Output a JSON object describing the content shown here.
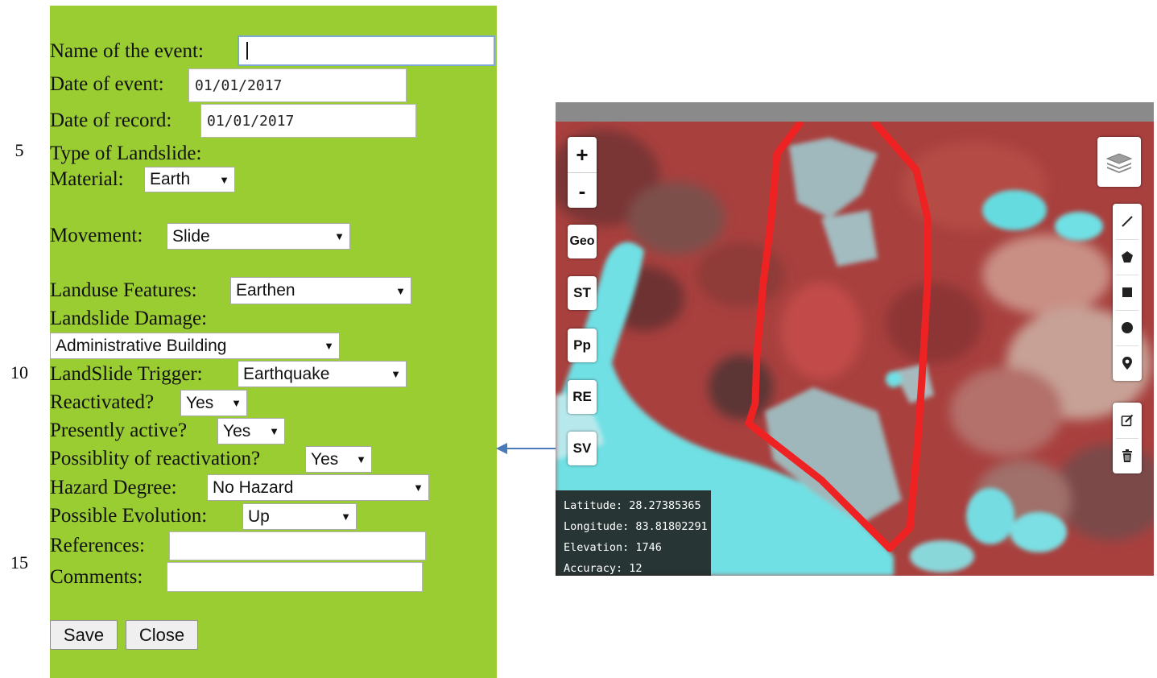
{
  "line_numbers": [
    "5",
    "10",
    "15"
  ],
  "form": {
    "event_name": {
      "label": "Name of the event:",
      "value": ""
    },
    "event_date": {
      "label": "Date of event:",
      "value": "01/01/2017"
    },
    "record_date": {
      "label": "Date of record:",
      "value": "01/01/2017"
    },
    "type_heading": "Type of Landslide:",
    "material": {
      "label": "Material:",
      "value": "Earth"
    },
    "movement": {
      "label": "Movement:",
      "value": "Slide"
    },
    "landuse": {
      "label": "Landuse Features:",
      "value": "Earthen"
    },
    "damage": {
      "label": "Landslide Damage:",
      "value": "Administrative Building"
    },
    "trigger": {
      "label": "LandSlide Trigger:",
      "value": "Earthquake"
    },
    "reactivated": {
      "label": "Reactivated?",
      "value": "Yes"
    },
    "presently_active": {
      "label": "Presently active?",
      "value": "Yes"
    },
    "reactivation_possibility": {
      "label": "Possiblity of reactivation?",
      "value": "Yes"
    },
    "hazard": {
      "label": "Hazard Degree:",
      "value": "No Hazard"
    },
    "evolution": {
      "label": "Possible Evolution:",
      "value": "Up"
    },
    "references": {
      "label": "References:",
      "value": ""
    },
    "comments": {
      "label": "Comments:",
      "value": ""
    },
    "save_label": "Save",
    "close_label": "Close"
  },
  "map": {
    "zoom_in": "+",
    "zoom_out": "-",
    "side_buttons": [
      "Geo",
      "ST",
      "Pp",
      "RE",
      "SV"
    ],
    "draw_tools": [
      "polyline-icon",
      "polygon-icon",
      "rectangle-icon",
      "circle-icon",
      "marker-icon"
    ],
    "edit_tools": [
      "edit-icon",
      "trash-icon"
    ],
    "layers_icon": "layers-icon",
    "coordinates": {
      "latitude": "Latitude: 28.27385365",
      "longitude": "Longitude: 83.81802291",
      "elevation": "Elevation: 1746",
      "accuracy": "Accuracy: 12"
    }
  },
  "colors": {
    "form_background": "#9acd32",
    "landslide_polygon": "#ee2222",
    "water": "#6fe0e4",
    "vegetation": "#a8403e",
    "connector_arrow": "#4a7ab8"
  }
}
